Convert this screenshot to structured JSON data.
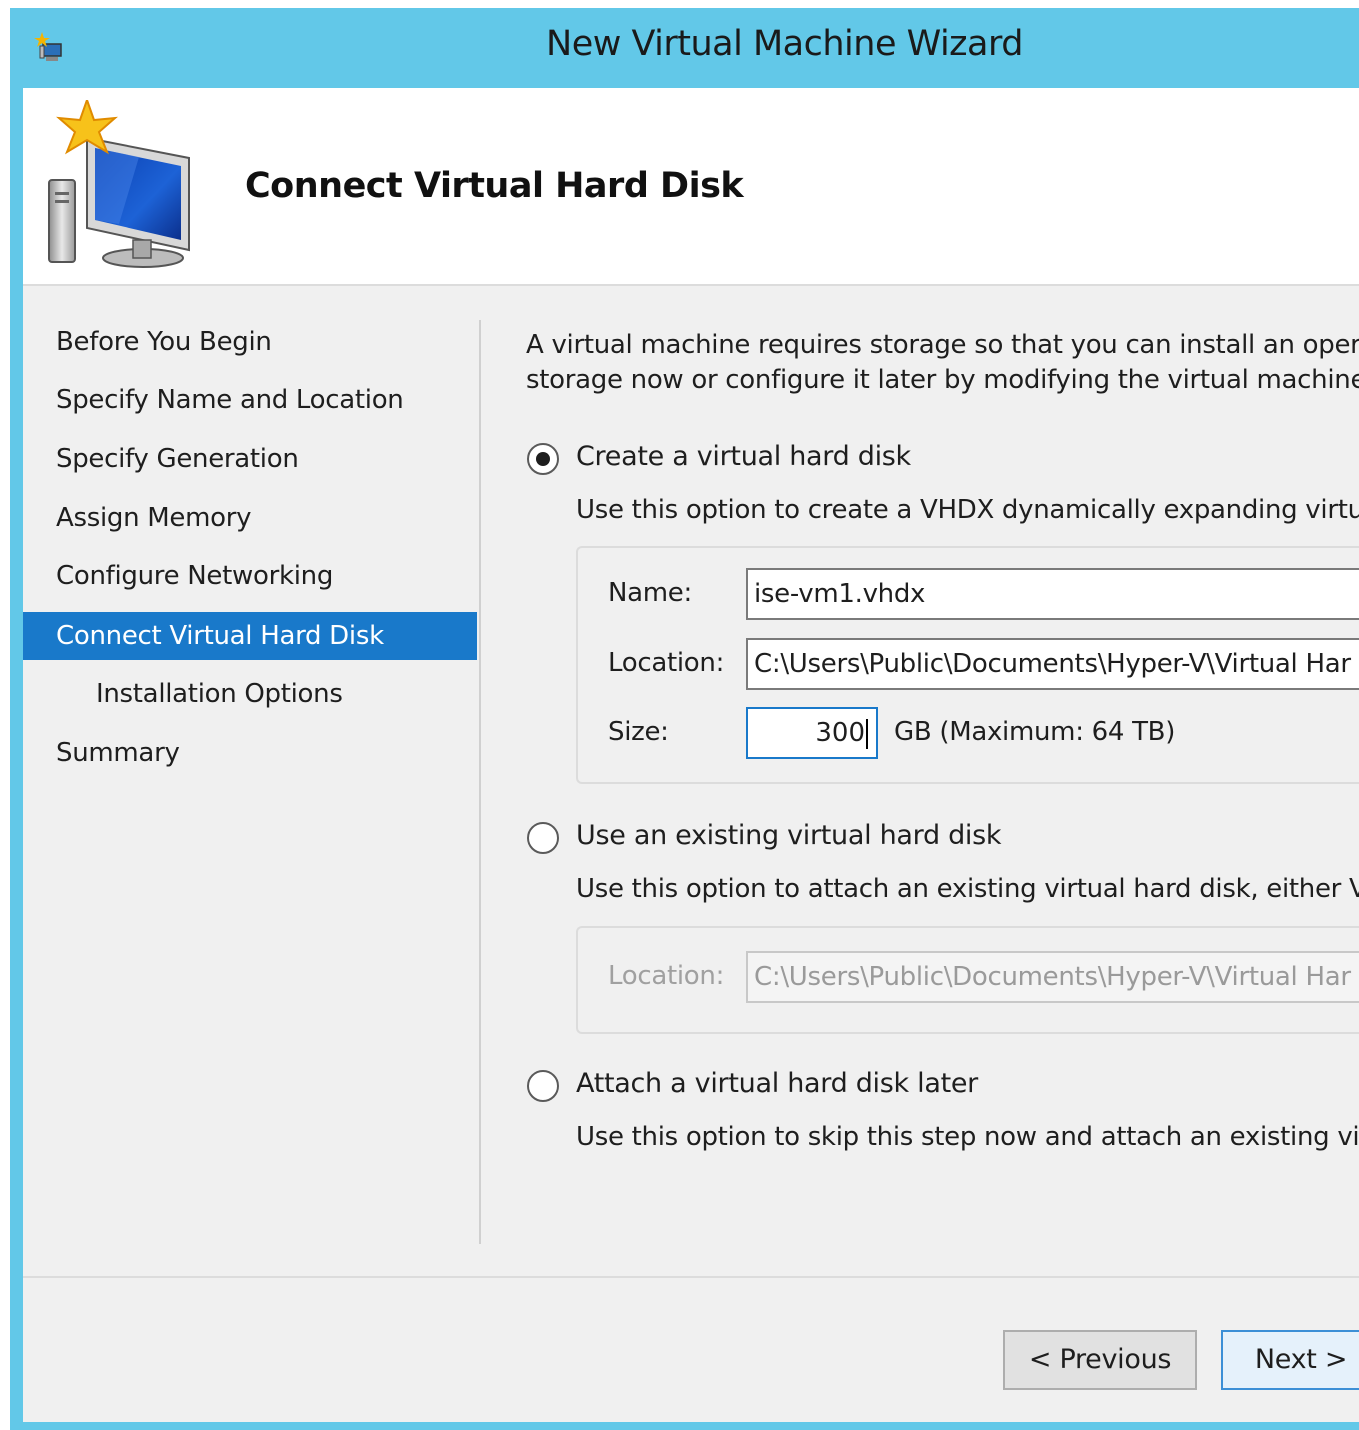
{
  "window": {
    "title": "New Virtual Machine Wizard"
  },
  "header": {
    "title": "Connect Virtual Hard Disk"
  },
  "nav": {
    "items": [
      {
        "label": "Before You Begin"
      },
      {
        "label": "Specify Name and Location"
      },
      {
        "label": "Specify Generation"
      },
      {
        "label": "Assign Memory"
      },
      {
        "label": "Configure Networking"
      },
      {
        "label": "Connect Virtual Hard Disk"
      },
      {
        "label": "Installation Options"
      },
      {
        "label": "Summary"
      }
    ],
    "active_index": 5
  },
  "main": {
    "description": "A virtual machine requires storage so that you can install an oper\nstorage now or configure it later by modifying the virtual machine",
    "option_create": {
      "label": "Create a virtual hard disk",
      "selected": true,
      "description": "Use this option to create a VHDX dynamically expanding virtu",
      "name_label": "Name:",
      "name_value": "ise-vm1.vhdx",
      "location_label": "Location:",
      "location_value": "C:\\Users\\Public\\Documents\\Hyper-V\\Virtual Har",
      "size_label": "Size:",
      "size_value": "300",
      "size_unit": "GB (Maximum: 64 TB)"
    },
    "option_existing": {
      "label": "Use an existing virtual hard disk",
      "selected": false,
      "description": "Use this option to attach an existing virtual hard disk, either V",
      "location_label": "Location:",
      "location_value": "C:\\Users\\Public\\Documents\\Hyper-V\\Virtual Har"
    },
    "option_later": {
      "label": "Attach a virtual hard disk later",
      "selected": false,
      "description": "Use this option to skip this step now and attach an existing vi"
    }
  },
  "footer": {
    "previous_label": "< Previous",
    "next_label": "Next >"
  },
  "colors": {
    "title_bar": "#62c8e8",
    "selection": "#1979ca"
  }
}
